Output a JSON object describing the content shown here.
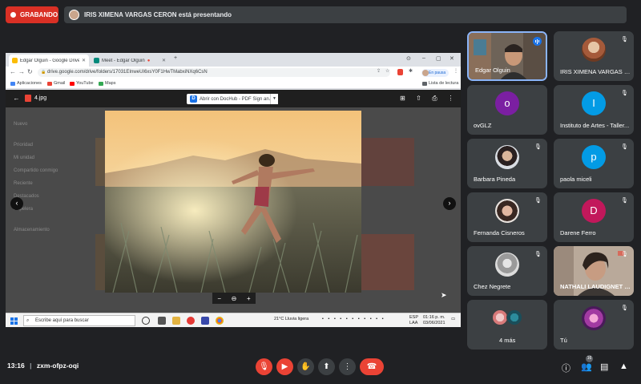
{
  "recording": {
    "label": "GRABANDO"
  },
  "presenting_banner": {
    "text": "IRIS XIMENA VARGAS CERON está presentando"
  },
  "browser": {
    "tabs": [
      {
        "label": "Edgar Olguin - Google Drive"
      },
      {
        "label": "Meet - Edgar Olguin"
      }
    ],
    "url": "drive.google.com/drive/folders/17031EInweUI6xsY0F1HwTMabxiNXq6CsN",
    "pause_label": "En pausa",
    "bookmarks": [
      "Aplicaciones",
      "Gmail",
      "YouTube",
      "Maps"
    ],
    "reading_list": "Lista de lectura"
  },
  "viewer": {
    "file_name": "4.jpg",
    "open_with": "Abrir con DocHub - PDF Sign an...",
    "zoom_minus": "−",
    "zoom_plus": "+"
  },
  "drive_sidebar_ghost": [
    "Nuevo",
    "Prioridad",
    "Mi unidad",
    "Compartido conmigo",
    "Reciente",
    "Destacados",
    "Papelera",
    "Almacenamiento"
  ],
  "taskbar": {
    "search_placeholder": "Escribe aquí para buscar",
    "weather": "21°C  Lluvia ligera",
    "lang": "ESP",
    "lang2": "LAA",
    "time": "01:16 p. m.",
    "date": "03/06/2021"
  },
  "participants": [
    {
      "name": "Edgar Olguin",
      "type": "video",
      "speaking": true
    },
    {
      "name": "IRIS XIMENA VARGAS CE...",
      "type": "photo",
      "muted": true
    },
    {
      "name": "ovGLZ",
      "type": "letter",
      "letter": "o",
      "color": "#7b1fa2",
      "muted": false
    },
    {
      "name": "Instituto de Artes - Taller...",
      "type": "letter",
      "letter": "I",
      "color": "#039be5",
      "muted": true
    },
    {
      "name": "Barbara Pineda",
      "type": "photo",
      "muted": true
    },
    {
      "name": "paola miceli",
      "type": "letter",
      "letter": "p",
      "color": "#039be5",
      "muted": true
    },
    {
      "name": "Fernanda Cisneros",
      "type": "photo",
      "muted": true
    },
    {
      "name": "Darene Ferro",
      "type": "letter",
      "letter": "D",
      "color": "#c2185b",
      "muted": true
    },
    {
      "name": "Chez Negrete",
      "type": "photo",
      "muted": true
    },
    {
      "name": "NATHALI LAUDIGNET MI...",
      "type": "video",
      "muted": true
    },
    {
      "name": "4 más",
      "type": "more"
    },
    {
      "name": "Tú",
      "type": "photo",
      "muted": true
    }
  ],
  "bottom": {
    "time": "13:16",
    "meeting_code": "zxm-ofpz-oqi",
    "participant_count": "16"
  }
}
